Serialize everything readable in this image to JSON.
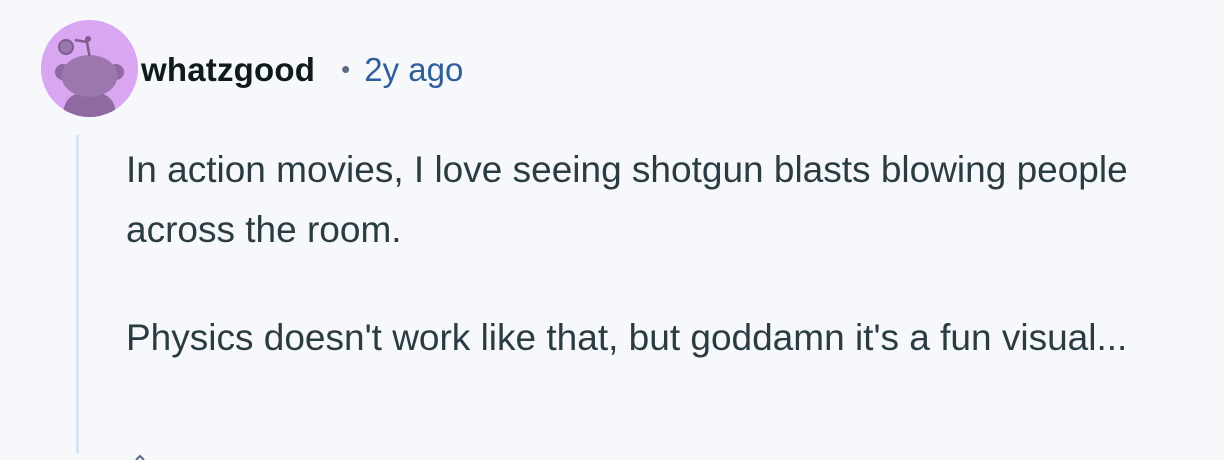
{
  "comment": {
    "author": {
      "username": "whatzgood",
      "avatar_icon": "snoo-avatar-icon",
      "avatar_bg_color": "#d9a6f2"
    },
    "separator": "•",
    "timestamp": "2y ago",
    "paragraphs": [
      "In action movies, I love seeing shotgun blasts blowing people across the room.",
      "Physics doesn't work like that, but goddamn it's a fun visual..."
    ]
  }
}
